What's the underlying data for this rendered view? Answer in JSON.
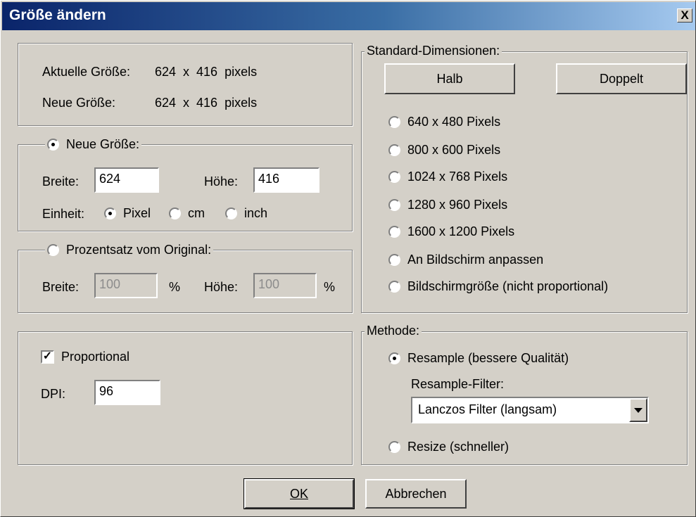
{
  "window": {
    "title": "Größe ändern",
    "close": "X"
  },
  "info": {
    "current_label": "Aktuelle Größe:",
    "current_value": "624  x  416  pixels",
    "new_label": "Neue Größe:",
    "new_value": "624  x  416  pixels"
  },
  "neue_groesse": {
    "radio_label": "Neue Größe:",
    "selected": true,
    "breite_label": "Breite:",
    "breite_value": "624",
    "hoehe_label": "Höhe:",
    "hoehe_value": "416",
    "einheit_label": "Einheit:",
    "units": [
      {
        "label": "Pixel",
        "selected": true
      },
      {
        "label": "cm",
        "selected": false
      },
      {
        "label": "inch",
        "selected": false
      }
    ]
  },
  "prozent": {
    "radio_label": "Prozentsatz vom Original:",
    "selected": false,
    "breite_label": "Breite:",
    "breite_value": "100",
    "breite_unit": "%",
    "hoehe_label": "Höhe:",
    "hoehe_value": "100",
    "hoehe_unit": "%"
  },
  "proportional": {
    "label": "Proportional",
    "checked": true,
    "dpi_label": "DPI:",
    "dpi_value": "96"
  },
  "standard": {
    "legend": "Standard-Dimensionen:",
    "halb": "Halb",
    "doppelt": "Doppelt",
    "options": [
      "640 x 480 Pixels",
      "800 x 600 Pixels",
      "1024 x 768 Pixels",
      "1280 x 960 Pixels",
      "1600 x 1200 Pixels",
      "An Bildschirm anpassen",
      "Bildschirmgröße (nicht proportional)"
    ]
  },
  "methode": {
    "legend": "Methode:",
    "resample_label": "Resample (bessere Qualität)",
    "resample_selected": true,
    "filter_label": "Resample-Filter:",
    "filter_value": "Lanczos Filter (langsam)",
    "resize_label": "Resize (schneller)"
  },
  "buttons": {
    "ok": "OK",
    "cancel": "Abbrechen"
  }
}
